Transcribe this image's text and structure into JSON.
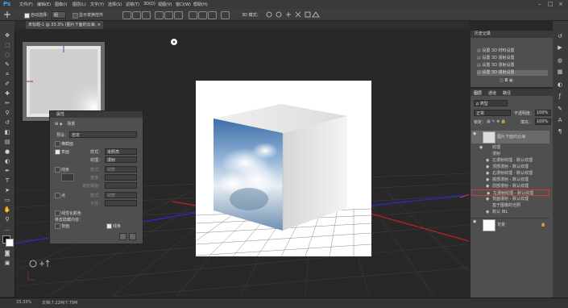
{
  "app": {
    "logo": "Ps"
  },
  "menu": [
    "文件(F)",
    "编辑(E)",
    "图像(I)",
    "图层(L)",
    "文字(Y)",
    "选择(S)",
    "滤镜(T)",
    "3D(D)",
    "视图(V)",
    "窗口(W)",
    "帮助(H)"
  ],
  "window_controls": {
    "min": "–",
    "max": "□",
    "close": "×"
  },
  "options": {
    "auto_select_label": "自动选择：",
    "auto_select_value": "组",
    "show_transform": "显示变换控件",
    "mode_label": "3D 模式："
  },
  "document_tab": {
    "title": "未标题-1 @ 33.3% (图片下面的云海, RGB/8#) *",
    "close": "×"
  },
  "status": {
    "zoom": "33.33%",
    "doc": "文档:7.22M/7.79M"
  },
  "history": {
    "title": "历史记录",
    "items": [
      "设置 3D 材料设置",
      "设置 3D 漫射设置",
      "设置 3D 漫射设置",
      "设置 3D 漫射设置"
    ]
  },
  "layers": {
    "tabs": [
      "图层",
      "通道",
      "路径"
    ],
    "filter_label": "ρ 类型",
    "blend_mode": "正常",
    "opacity_label": "不透明度：",
    "opacity": "100%",
    "lock_label": "锁定：",
    "fill_label": "填充：",
    "fill": "100%",
    "rows": [
      {
        "name": "图片下面的云海",
        "type": "layer"
      },
      {
        "name": "纹理",
        "type": "group"
      },
      {
        "name": "漫射",
        "type": "sub"
      },
      {
        "name": "左漫射纹理 - 默认纹理",
        "type": "item"
      },
      {
        "name": "顶部漫射 - 默认纹理",
        "type": "item"
      },
      {
        "name": "右漫射纹理 - 默认纹理",
        "type": "item"
      },
      {
        "name": "底部漫射 - 默认纹理",
        "type": "item"
      },
      {
        "name": "前部漫射 - 默认纹理",
        "type": "item"
      },
      {
        "name": "左漫射纹理 - 默认纹理",
        "type": "item",
        "highlighted": true
      },
      {
        "name": "背面漫射 - 默认纹理",
        "type": "item"
      },
      {
        "name": "基于图像的光照",
        "type": "sub"
      },
      {
        "name": "默认 IBL",
        "type": "item"
      },
      {
        "name": "背景",
        "type": "bg"
      }
    ]
  },
  "properties": {
    "title": "属性",
    "tab_label": "场景",
    "preset_label": "预设：",
    "preset_value": "自定",
    "cross_section_label": "横截面",
    "surface_label": "表面",
    "style_label": "样式：",
    "style_value": "未照亮",
    "texture_label": "纹理：",
    "texture_value": "漫射",
    "lines_label": "线条",
    "lines_style_label": "样式：",
    "lines_style_value": "常数",
    "width_label": "宽度：",
    "angle_label": "角度阈值：",
    "points_label": "点",
    "points_style_label": "样式：",
    "points_style_value": "常数",
    "radius_label": "半径：",
    "linearize_label": "线性化颜色",
    "hidden_label": "移去隐藏内容：",
    "backface_label": "背面",
    "lines2_label": "线条"
  },
  "colors": {
    "accent": "#31a8ff",
    "highlight": "#d43a3a"
  }
}
